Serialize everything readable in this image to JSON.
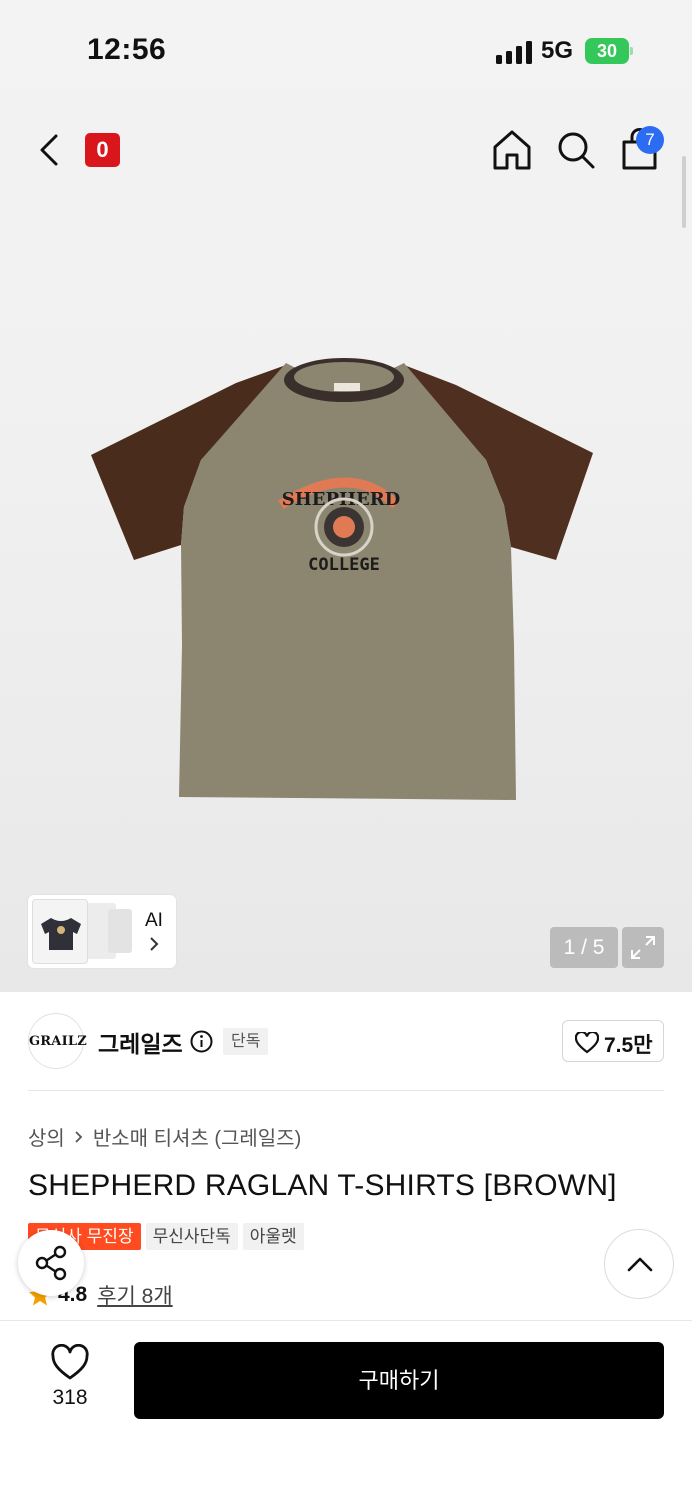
{
  "status_bar": {
    "time": "12:56",
    "network": "5G",
    "battery": "30"
  },
  "nav": {
    "logo_text": "0",
    "cart_count": "7",
    "icons": [
      "back-icon",
      "home-icon",
      "search-icon",
      "bag-icon"
    ]
  },
  "gallery": {
    "ai_label": "AI",
    "page_counter": "1 / 5"
  },
  "brand": {
    "logo_text": "GRAILZ",
    "name": "그레일즈",
    "exclusive_tag": "단독",
    "likes": "7.5만"
  },
  "breadcrumb": {
    "items": [
      "상의",
      "반소매 티셔츠 (그레일즈)"
    ]
  },
  "product": {
    "title": "SHEPHERD RAGLAN T-SHIRTS [BROWN]",
    "tags": [
      "무신사 무진장",
      "무신사단독",
      "아울렛"
    ],
    "rating": "4.8",
    "review_link": "후기 8개"
  },
  "bottom": {
    "like_count": "318",
    "buy_label": "구매하기"
  },
  "colors": {
    "accent_red": "#ff4b1f",
    "logo_red": "#d9161c",
    "badge_blue": "#2c6cf3",
    "battery_green": "#34c759"
  }
}
